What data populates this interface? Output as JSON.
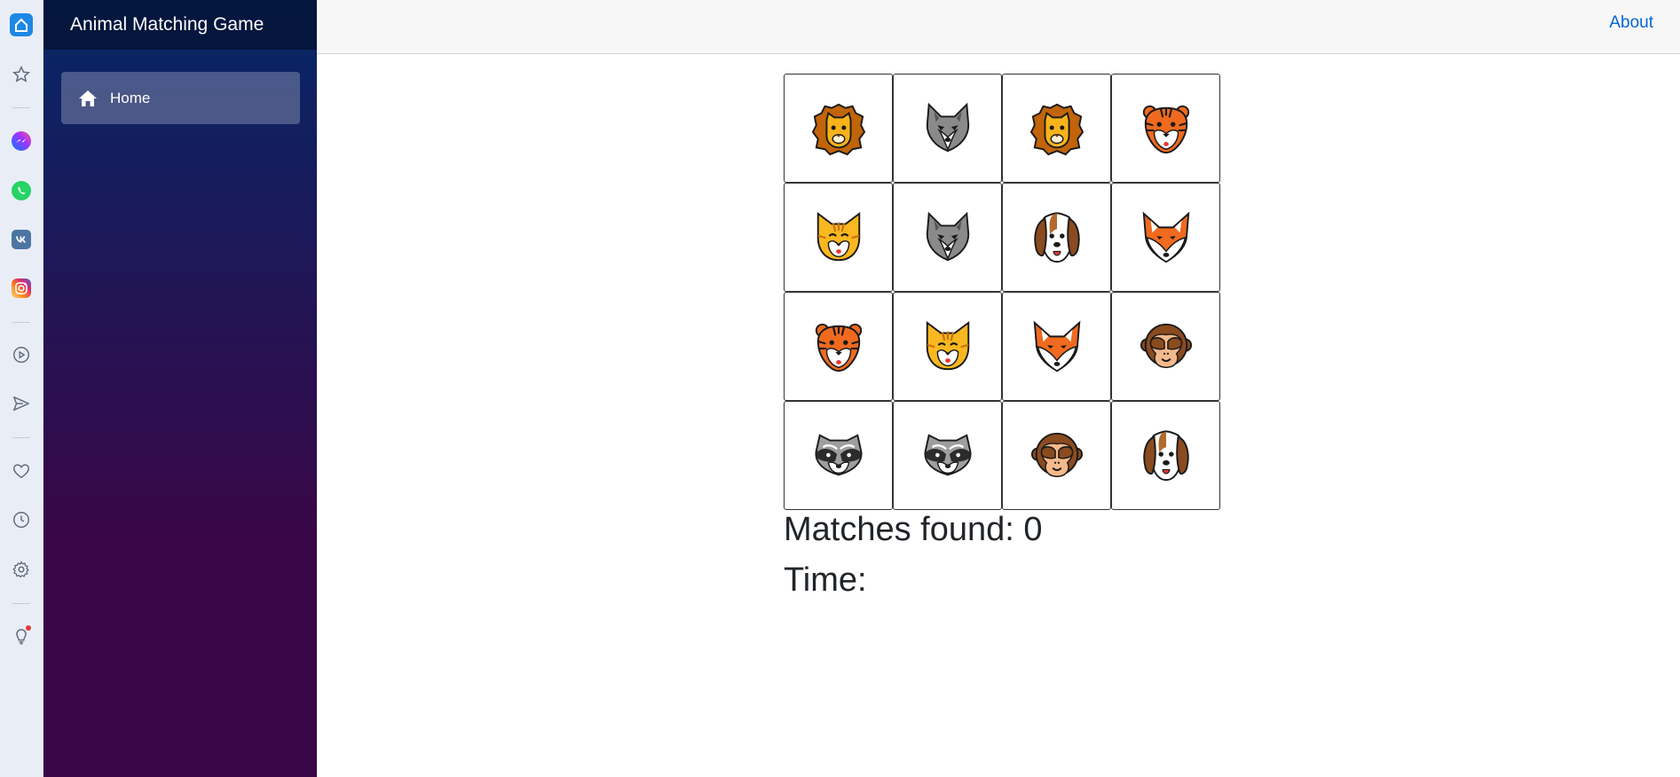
{
  "app": {
    "title": "Animal Matching Game"
  },
  "sidebar": {
    "items": [
      {
        "label": "Home",
        "icon": "home-icon"
      }
    ]
  },
  "topbar": {
    "about_label": "About"
  },
  "browser_rail": {
    "icons": [
      "home-icon",
      "star-icon",
      "messenger-icon",
      "whatsapp-icon",
      "vk-icon",
      "instagram-icon",
      "play-icon",
      "send-icon",
      "heart-icon",
      "clock-icon",
      "gear-icon",
      "lightbulb-icon"
    ]
  },
  "game": {
    "cards": [
      [
        "lion",
        "wolf",
        "lion",
        "tiger"
      ],
      [
        "cat",
        "wolf",
        "dog",
        "fox"
      ],
      [
        "tiger",
        "cat",
        "fox",
        "monkey"
      ],
      [
        "raccoon",
        "raccoon",
        "monkey",
        "dog"
      ]
    ],
    "matches_label": "Matches found: 0",
    "time_label": "Time:"
  },
  "colors": {
    "sidebar_top": "#052767",
    "sidebar_bottom": "#3a0647",
    "link": "#0366d6"
  }
}
